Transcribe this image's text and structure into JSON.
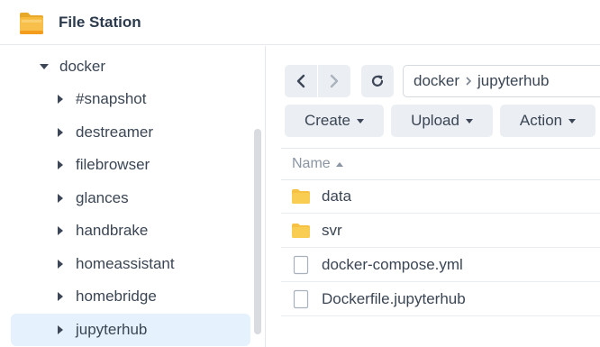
{
  "app": {
    "title": "File Station",
    "icon": "folder-app-icon"
  },
  "sidebar": {
    "root": {
      "label": "docker",
      "expanded": true
    },
    "items": [
      {
        "label": "#snapshot"
      },
      {
        "label": "destreamer"
      },
      {
        "label": "filebrowser"
      },
      {
        "label": "glances"
      },
      {
        "label": "handbrake"
      },
      {
        "label": "homeassistant"
      },
      {
        "label": "homebridge"
      },
      {
        "label": "jupyterhub",
        "selected": true
      }
    ]
  },
  "navigation": {
    "back_icon": "chevron-left-icon",
    "forward_icon": "chevron-right-icon",
    "refresh_icon": "refresh-icon",
    "path": [
      "docker",
      "jupyterhub"
    ]
  },
  "toolbar": {
    "create_label": "Create",
    "upload_label": "Upload",
    "action_label": "Action"
  },
  "file_list": {
    "header_name": "Name",
    "sort": "ascending",
    "rows": [
      {
        "name": "data",
        "type": "folder"
      },
      {
        "name": "svr",
        "type": "folder"
      },
      {
        "name": "docker-compose.yml",
        "type": "file"
      },
      {
        "name": "Dockerfile.jupyterhub",
        "type": "file"
      }
    ]
  },
  "colors": {
    "folder": "#f7c244",
    "selected_bg": "#e5f1fd",
    "button_bg": "#ebeef3"
  }
}
